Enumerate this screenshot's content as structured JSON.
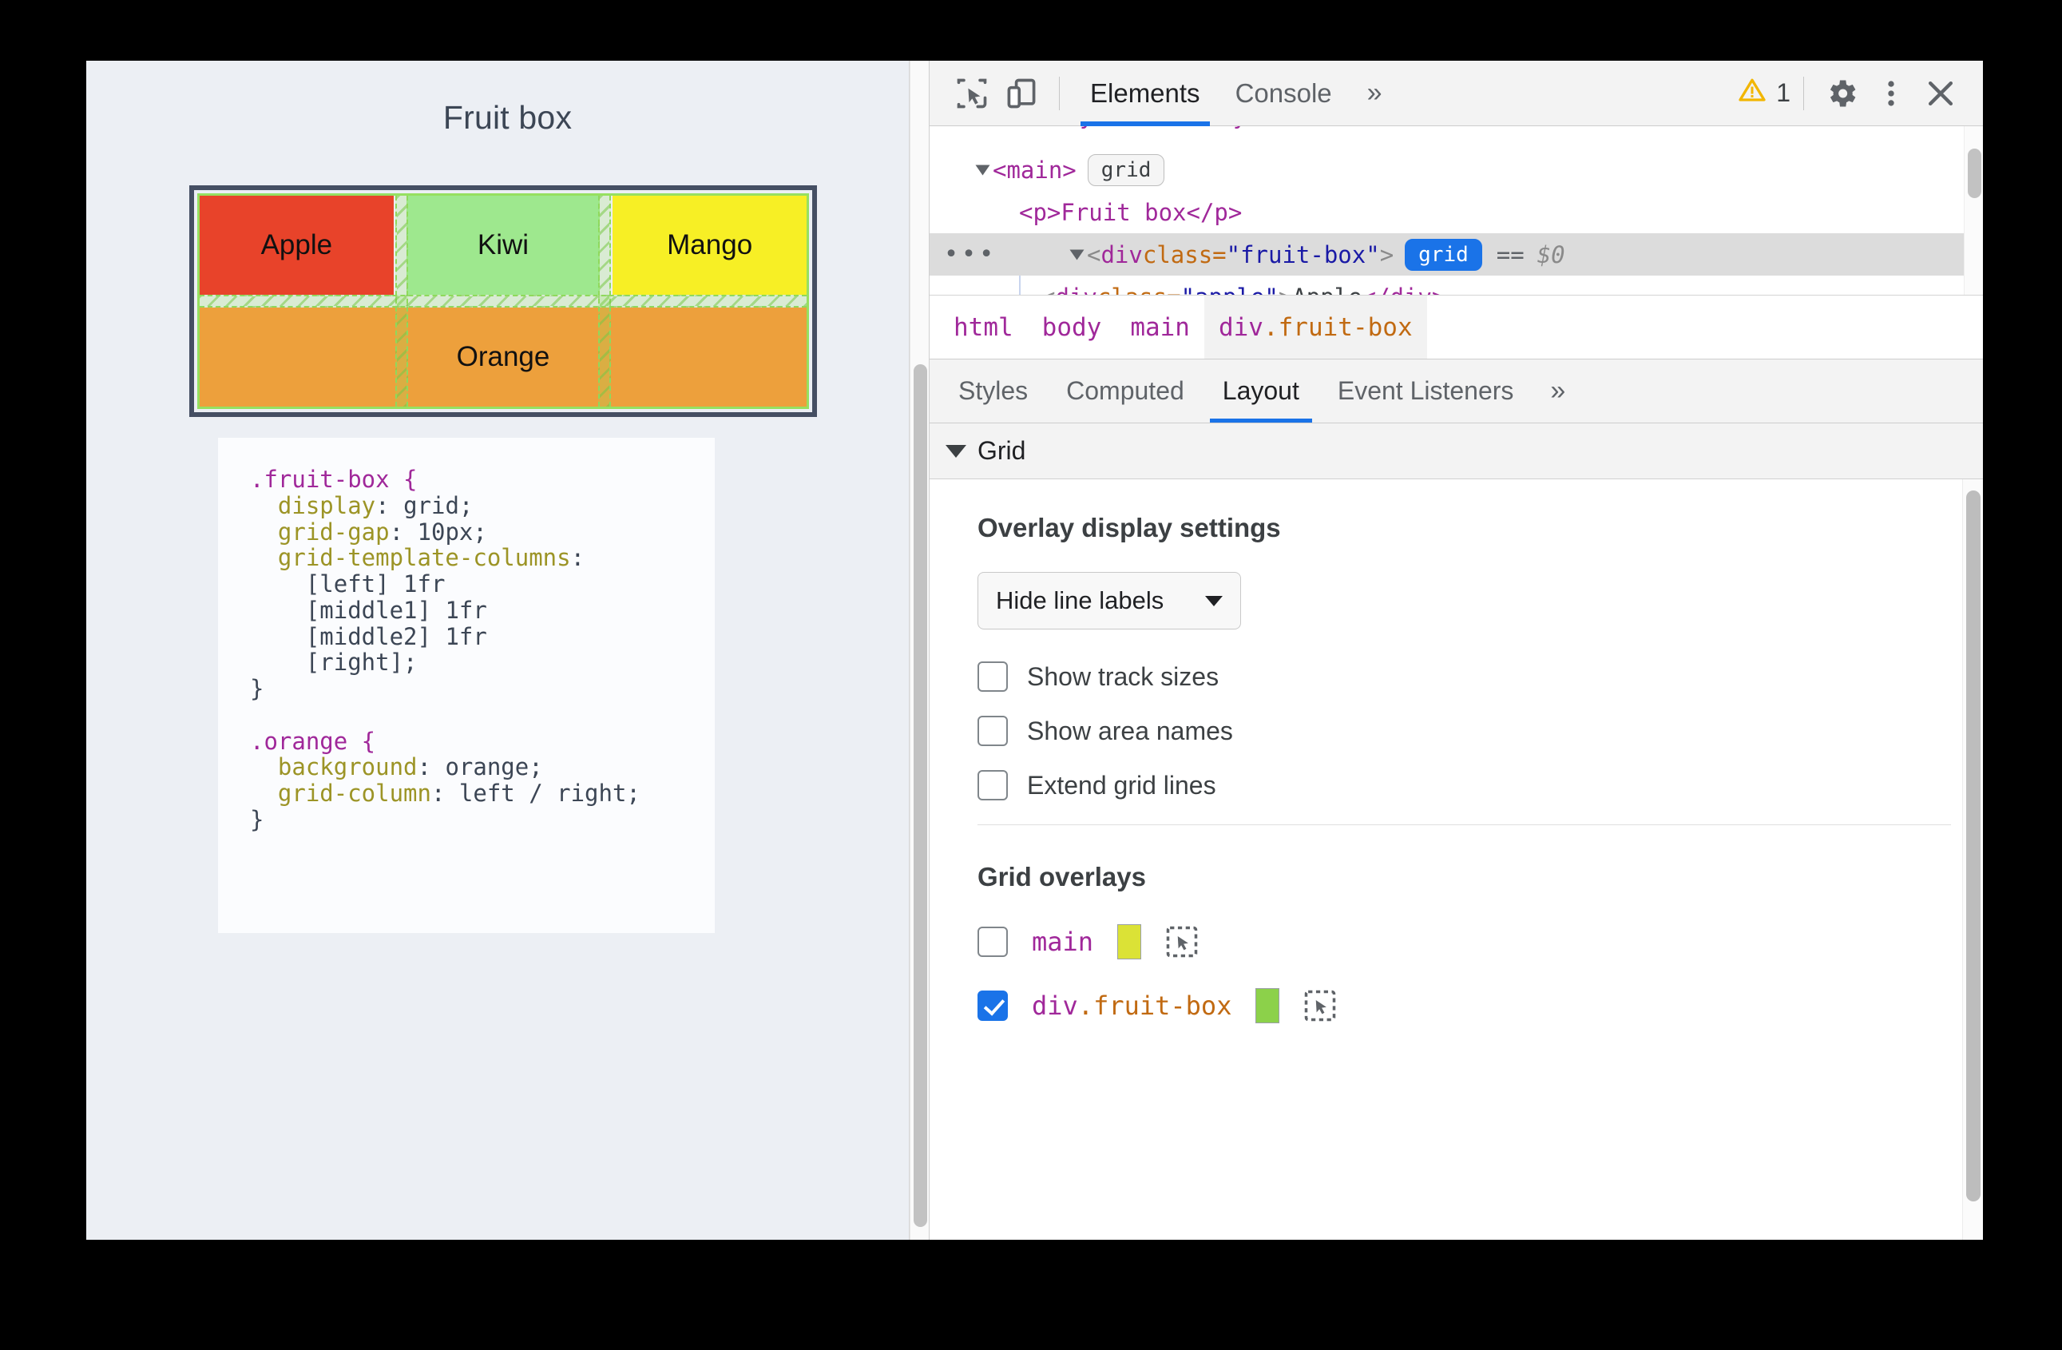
{
  "viewport": {
    "page_title": "Fruit box",
    "grid": {
      "cells": [
        {
          "label": "Apple",
          "color": "#e8432a"
        },
        {
          "label": "Kiwi",
          "color": "#9ee88e"
        },
        {
          "label": "Mango",
          "color": "#f7ef25"
        },
        {
          "label": "Orange",
          "color": "#eda03c"
        }
      ]
    },
    "code": {
      "rule1_selector": ".fruit-box {",
      "rule1_lines": [
        {
          "prop": "display",
          "value": "grid;"
        },
        {
          "prop": "grid-gap",
          "value": "10px;"
        },
        {
          "prop": "grid-template-columns",
          "value": ""
        }
      ],
      "rule1_tracks": [
        "[left] 1fr",
        "[middle1] 1fr",
        "[middle2] 1fr",
        "[right];"
      ],
      "rule1_close": "}",
      "rule2_selector": ".orange {",
      "rule2_lines": [
        {
          "prop": "background",
          "value": "orange;"
        },
        {
          "prop": "grid-column",
          "value": "left / right;"
        }
      ],
      "rule2_close": "}"
    }
  },
  "devtools": {
    "toolbar": {
      "inspect_icon": "inspect-element-icon",
      "device_icon": "device-toolbar-icon",
      "tabs": [
        {
          "label": "Elements",
          "active": true
        },
        {
          "label": "Console",
          "active": false
        }
      ],
      "more_tabs": "»",
      "warning_icon": "warning-triangle-icon",
      "warning_count": "1",
      "settings_icon": "gear-icon",
      "kebab_icon": "more-vertical-icon",
      "close_icon": "close-icon"
    },
    "dom_tree": {
      "rows": [
        {
          "indent": 60,
          "has_triangle": true,
          "open_tag": "<main>",
          "badge": "grid",
          "badge_on": false,
          "selected": false
        },
        {
          "indent": 112,
          "has_triangle": false,
          "text": "<p>Fruit box</p>",
          "selected": false
        },
        {
          "indent": 90,
          "has_triangle": true,
          "tag_open": "<div ",
          "attr_name": "class=",
          "attr_value": "\"fruit-box\"",
          "tag_close": ">",
          "badge": "grid",
          "badge_on": true,
          "eq": "==",
          "dollar": "$0",
          "ellipsis": "•••",
          "selected": true
        },
        {
          "indent": 140,
          "has_triangle": false,
          "tag_open": "<div ",
          "attr_name": "class=",
          "attr_value": "\"apple\"",
          "tag_close": ">",
          "inner_text": "Apple",
          "end_tag": "</div>",
          "selected": false
        }
      ]
    },
    "breadcrumb": [
      {
        "label": "html",
        "active": false
      },
      {
        "label": "body",
        "active": false
      },
      {
        "label": "main",
        "active": false
      },
      {
        "label": "div",
        "suffix": ".fruit-box",
        "active": true
      }
    ],
    "pane_tabs": [
      {
        "label": "Styles",
        "active": false
      },
      {
        "label": "Computed",
        "active": false
      },
      {
        "label": "Layout",
        "active": true
      },
      {
        "label": "Event Listeners",
        "active": false
      }
    ],
    "pane_more": "»",
    "grid_section": {
      "header": "Grid",
      "overlay_settings_title": "Overlay display settings",
      "line_labels_select": {
        "value": "Hide line labels"
      },
      "checkboxes": [
        {
          "label": "Show track sizes",
          "checked": false
        },
        {
          "label": "Show area names",
          "checked": false
        },
        {
          "label": "Extend grid lines",
          "checked": false
        }
      ],
      "overlays_title": "Grid overlays",
      "overlays": [
        {
          "name": "main",
          "suffix": "",
          "checked": false,
          "color": "#dbe236",
          "pick_icon": "select-element-icon"
        },
        {
          "name": "div",
          "suffix": ".fruit-box",
          "checked": true,
          "color": "#8cd14a",
          "pick_icon": "select-element-icon"
        }
      ]
    }
  },
  "colors": {
    "accent": "#1a73e8",
    "tag": "#a0289a",
    "attr_name": "#c16a12",
    "attr_value": "#1a1aa6",
    "grid_overlay": "#96e060"
  }
}
